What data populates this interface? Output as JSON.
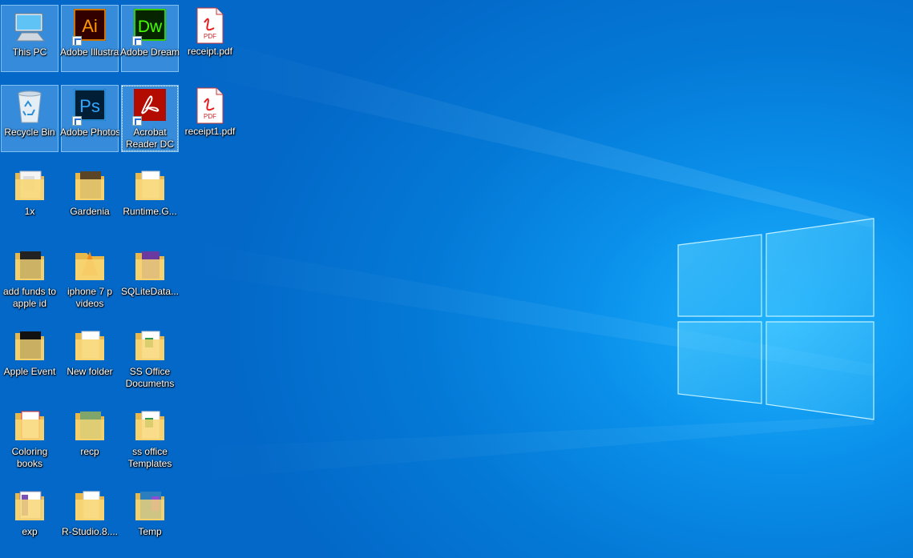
{
  "desktop": {
    "icons": [
      {
        "label": "This PC",
        "icon": "this-pc-icon"
      },
      {
        "label": "Adobe Illustrat...",
        "icon": "adobe-illustrator-icon"
      },
      {
        "label": "Adobe Dreamwea...",
        "icon": "adobe-dreamweaver-icon"
      },
      {
        "label": "receipt.pdf",
        "icon": "pdf-file-icon"
      },
      {
        "label": "Recycle Bin",
        "icon": "recycle-bin-icon"
      },
      {
        "label": "Adobe Photosh...",
        "icon": "adobe-photoshop-icon"
      },
      {
        "label": "Acrobat Reader DC",
        "icon": "acrobat-reader-icon"
      },
      {
        "label": "receipt1.pdf",
        "icon": "pdf-file-icon"
      },
      {
        "label": "1x",
        "icon": "folder-icon"
      },
      {
        "label": "Gardenia",
        "icon": "folder-icon"
      },
      {
        "label": "Runtime.G...",
        "icon": "folder-icon"
      },
      {
        "label": "add funds to apple id",
        "icon": "folder-icon"
      },
      {
        "label": "iphone 7 p videos",
        "icon": "folder-icon"
      },
      {
        "label": "SQLiteData...",
        "icon": "folder-icon"
      },
      {
        "label": "Apple Event",
        "icon": "folder-icon"
      },
      {
        "label": "New folder",
        "icon": "folder-icon"
      },
      {
        "label": "SS Office Documetns",
        "icon": "folder-icon"
      },
      {
        "label": "Coloring books",
        "icon": "folder-icon"
      },
      {
        "label": "recp",
        "icon": "folder-icon"
      },
      {
        "label": "ss office Templates",
        "icon": "folder-icon"
      },
      {
        "label": "exp",
        "icon": "folder-icon"
      },
      {
        "label": "R-Studio.8....",
        "icon": "folder-icon"
      },
      {
        "label": "Temp",
        "icon": "folder-icon"
      }
    ],
    "pdf_badge": "PDF",
    "app_badges": {
      "illustrator": "Ai",
      "dreamweaver": "Dw",
      "photoshop": "Ps"
    }
  },
  "colors": {
    "desktop_blue": "#0078d7",
    "illustrator": "#ff9a00",
    "dreamweaver": "#46ff00",
    "photoshop": "#31a8ff",
    "acrobat": "#e81c1c",
    "folder": "#f8d775"
  }
}
